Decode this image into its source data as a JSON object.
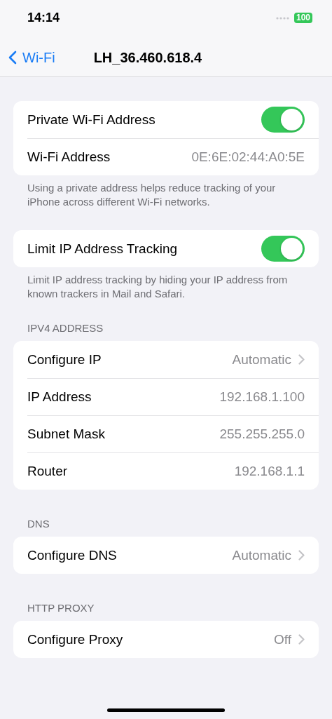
{
  "status_bar": {
    "time": "14:14",
    "battery": "100"
  },
  "nav": {
    "back_label": "Wi-Fi",
    "title": "LH_36.460.618.4"
  },
  "sections": [
    {
      "rows": [
        {
          "kind": "toggle",
          "label": "Private Wi-Fi Address",
          "on": true
        },
        {
          "kind": "value",
          "label": "Wi-Fi Address",
          "value": "0E:6E:02:44:A0:5E"
        }
      ],
      "footer": "Using a private address helps reduce tracking of your iPhone across different Wi-Fi networks."
    },
    {
      "rows": [
        {
          "kind": "toggle",
          "label": "Limit IP Address Tracking",
          "on": true
        }
      ],
      "footer": "Limit IP address tracking by hiding your IP address from known trackers in Mail and Safari."
    },
    {
      "header": "IPV4 ADDRESS",
      "rows": [
        {
          "kind": "link",
          "label": "Configure IP",
          "value": "Automatic"
        },
        {
          "kind": "value",
          "label": "IP Address",
          "value": "192.168.1.100"
        },
        {
          "kind": "value",
          "label": "Subnet Mask",
          "value": "255.255.255.0"
        },
        {
          "kind": "value",
          "label": "Router",
          "value": "192.168.1.1"
        }
      ]
    },
    {
      "header": "DNS",
      "rows": [
        {
          "kind": "link",
          "label": "Configure DNS",
          "value": "Automatic"
        }
      ]
    },
    {
      "header": "HTTP PROXY",
      "rows": [
        {
          "kind": "link",
          "label": "Configure Proxy",
          "value": "Off"
        }
      ]
    }
  ]
}
